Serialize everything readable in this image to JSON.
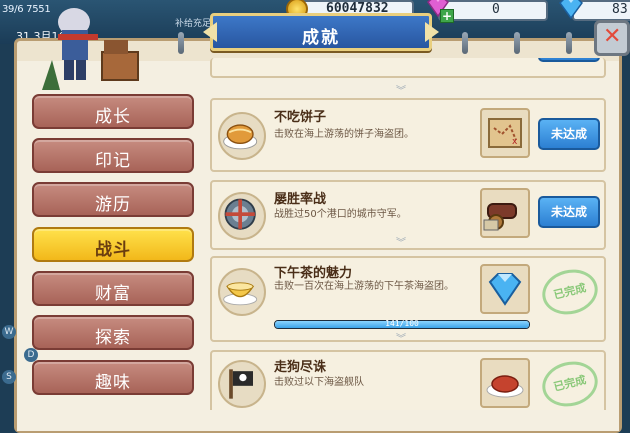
{
  "hud": {
    "level_text": "39/6 7551",
    "date_text": "31    3月16日",
    "note_text": "补给充足",
    "gold": "60047832",
    "gems": "0",
    "diamonds": "83"
  },
  "title": "成就",
  "tabs": [
    {
      "label": "成长",
      "active": false
    },
    {
      "label": "印记",
      "active": false
    },
    {
      "label": "游历",
      "active": false
    },
    {
      "label": "战斗",
      "active": true
    },
    {
      "label": "财富",
      "active": false
    },
    {
      "label": "探索",
      "active": false
    },
    {
      "label": "趣味",
      "active": false
    }
  ],
  "achievements": [
    {
      "title": "不吃饼子",
      "desc": "击败在海上游荡的饼子海盗团。",
      "icon": "pie-icon",
      "reward": "treasure-map-icon",
      "status": "未达成"
    },
    {
      "title": "屡胜率战",
      "desc": "战胜过50个港口的城市守军。",
      "icon": "shield-icon",
      "reward": "cannon-icon",
      "status": "未达成"
    },
    {
      "title": "下午茶的魅力",
      "desc": "击败一百次在海上游荡的下午茶海盗团。",
      "icon": "teacup-icon",
      "reward": "diamond-icon",
      "status": "已完成",
      "progress_text": "141/100",
      "progress": 1.0
    },
    {
      "title": "走狗尽诛",
      "desc": "击败过以下海盗舰队",
      "icon": "pirate-flag-icon",
      "reward": "meat-dish-icon",
      "status": "已完成"
    }
  ],
  "side_markers": [
    "W",
    "D",
    "S"
  ],
  "colors": {
    "tab_default": "#b3766a",
    "tab_active": "#f6c92a",
    "button_blue": "#3a8fde",
    "stamp_green": "#7ec46d",
    "panel_bg": "#ede4cf"
  }
}
